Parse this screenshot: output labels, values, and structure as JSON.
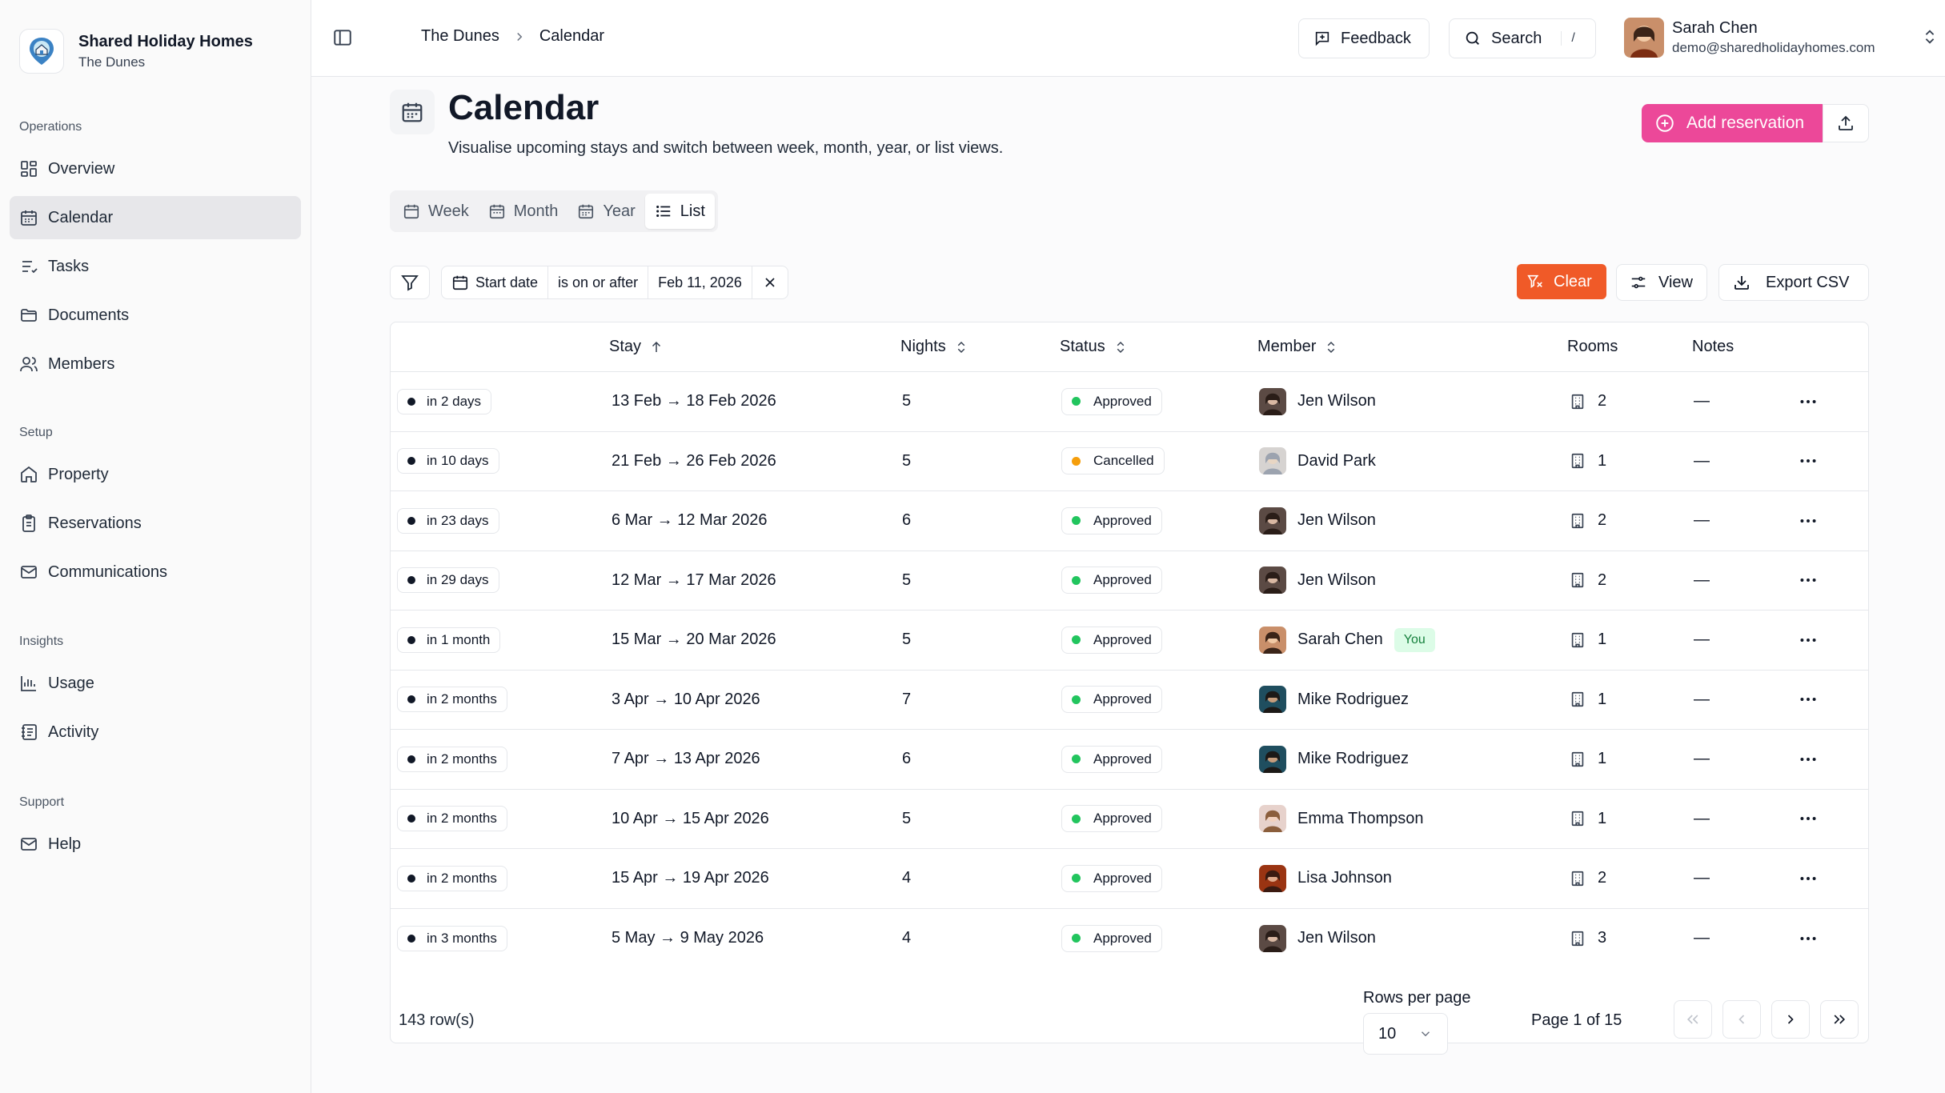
{
  "brand": {
    "name": "Shared Holiday Homes",
    "property": "The Dunes"
  },
  "sidebar": {
    "sections": [
      {
        "heading": "Operations",
        "items": [
          {
            "label": "Overview",
            "icon": "grid-icon"
          },
          {
            "label": "Calendar",
            "icon": "calendar-icon",
            "active": true
          },
          {
            "label": "Tasks",
            "icon": "tasks-icon"
          },
          {
            "label": "Documents",
            "icon": "folder-icon"
          },
          {
            "label": "Members",
            "icon": "users-icon"
          }
        ]
      },
      {
        "heading": "Setup",
        "items": [
          {
            "label": "Property",
            "icon": "home-icon"
          },
          {
            "label": "Reservations",
            "icon": "clipboard-icon"
          },
          {
            "label": "Communications",
            "icon": "mail-icon"
          }
        ]
      },
      {
        "heading": "Insights",
        "items": [
          {
            "label": "Usage",
            "icon": "bar-chart-icon"
          },
          {
            "label": "Activity",
            "icon": "activity-icon"
          }
        ]
      },
      {
        "heading": "Support",
        "items": [
          {
            "label": "Help",
            "icon": "mail-icon"
          }
        ]
      }
    ]
  },
  "topbar": {
    "breadcrumb": [
      "The Dunes",
      "Calendar"
    ],
    "feedback_label": "Feedback",
    "search_label": "Search",
    "search_shortcut": "/",
    "user": {
      "name": "Sarah Chen",
      "email": "demo@sharedholidayhomes.com"
    }
  },
  "page": {
    "title": "Calendar",
    "subtitle": "Visualise upcoming stays and switch between week, month, year, or list views.",
    "add_label": "Add reservation"
  },
  "view_tabs": [
    {
      "label": "Week",
      "icon": "calendar-icon"
    },
    {
      "label": "Month",
      "icon": "calendar-icon"
    },
    {
      "label": "Year",
      "icon": "calendar-icon"
    },
    {
      "label": "List",
      "icon": "list-icon",
      "active": true
    }
  ],
  "filter": {
    "field": "Start date",
    "operator": "is on or after",
    "value": "Feb 11, 2026"
  },
  "actions": {
    "clear": "Clear",
    "view": "View",
    "export": "Export CSV"
  },
  "table": {
    "columns": {
      "stay": "Stay",
      "nights": "Nights",
      "status": "Status",
      "member": "Member",
      "rooms": "Rooms",
      "notes": "Notes"
    },
    "rows": [
      {
        "relative": "in 2 days",
        "stay": "13 Feb → 18 Feb 2026",
        "nights": "5",
        "status": "Approved",
        "member": "Jen Wilson",
        "rooms": "2",
        "notes": "—"
      },
      {
        "relative": "in 10 days",
        "stay": "21 Feb → 26 Feb 2026",
        "nights": "5",
        "status": "Cancelled",
        "member": "David Park",
        "rooms": "1",
        "notes": "—"
      },
      {
        "relative": "in 23 days",
        "stay": "6 Mar → 12 Mar 2026",
        "nights": "6",
        "status": "Approved",
        "member": "Jen Wilson",
        "rooms": "2",
        "notes": "—"
      },
      {
        "relative": "in 29 days",
        "stay": "12 Mar → 17 Mar 2026",
        "nights": "5",
        "status": "Approved",
        "member": "Jen Wilson",
        "rooms": "2",
        "notes": "—"
      },
      {
        "relative": "in 1 month",
        "stay": "15 Mar → 20 Mar 2026",
        "nights": "5",
        "status": "Approved",
        "member": "Sarah Chen",
        "you": "You",
        "rooms": "1",
        "notes": "—"
      },
      {
        "relative": "in 2 months",
        "stay": "3 Apr → 10 Apr 2026",
        "nights": "7",
        "status": "Approved",
        "member": "Mike Rodriguez",
        "rooms": "1",
        "notes": "—"
      },
      {
        "relative": "in 2 months",
        "stay": "7 Apr → 13 Apr 2026",
        "nights": "6",
        "status": "Approved",
        "member": "Mike Rodriguez",
        "rooms": "1",
        "notes": "—"
      },
      {
        "relative": "in 2 months",
        "stay": "10 Apr → 15 Apr 2026",
        "nights": "5",
        "status": "Approved",
        "member": "Emma Thompson",
        "rooms": "1",
        "notes": "—"
      },
      {
        "relative": "in 2 months",
        "stay": "15 Apr → 19 Apr 2026",
        "nights": "4",
        "status": "Approved",
        "member": "Lisa Johnson",
        "rooms": "2",
        "notes": "—"
      },
      {
        "relative": "in 3 months",
        "stay": "5 May → 9 May 2026",
        "nights": "4",
        "status": "Approved",
        "member": "Jen Wilson",
        "rooms": "3",
        "notes": "—"
      }
    ]
  },
  "pagination": {
    "row_count": "143 row(s)",
    "rows_per_page_label": "Rows per page",
    "rows_per_page": "10",
    "page_info": "Page 1 of 15"
  },
  "colors": {
    "accent": "#ec4899",
    "clear": "#f05a28",
    "approved": "#22c55e",
    "cancelled": "#f59e0b",
    "you_bg": "#dcfce7"
  }
}
